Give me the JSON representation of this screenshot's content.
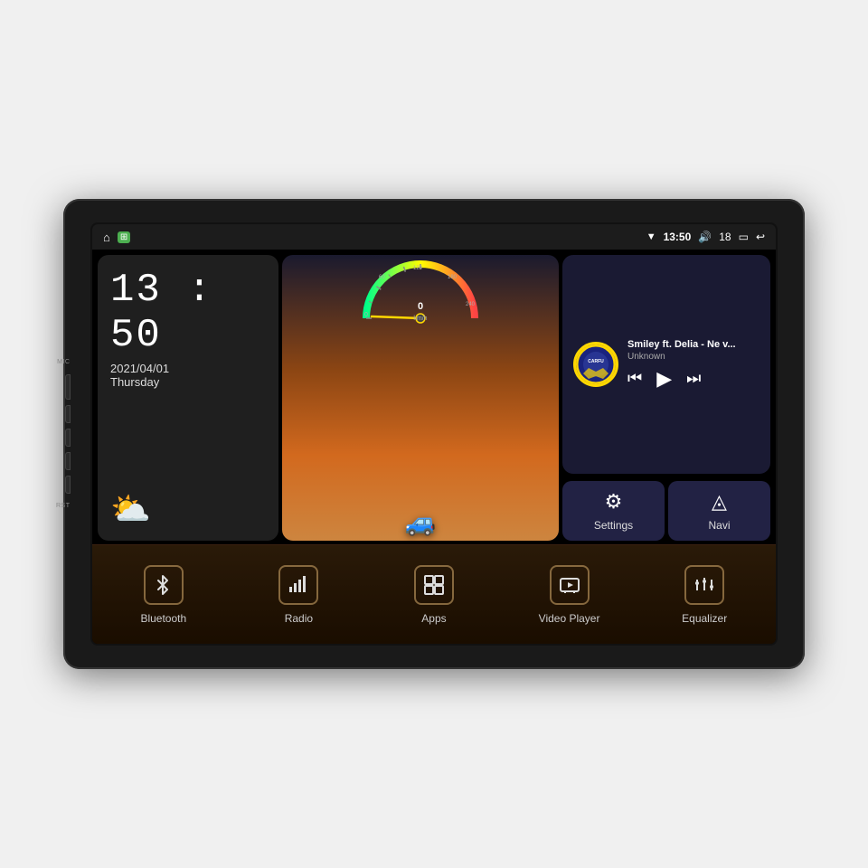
{
  "device": {
    "side_labels": {
      "mic": "MIC",
      "rst": "RST"
    }
  },
  "status_bar": {
    "wifi_icon": "▼",
    "time": "13:50",
    "volume_icon": "🔊",
    "volume_level": "18",
    "battery_icon": "🔋",
    "back_icon": "↩",
    "home_icon": "⌂",
    "app_icon": "⊞"
  },
  "clock": {
    "time": "13 : 50",
    "date": "2021/04/01",
    "day": "Thursday"
  },
  "music": {
    "logo_text": "CARFU",
    "title": "Smiley ft. Delia - Ne v...",
    "artist": "Unknown"
  },
  "settings_btn": {
    "label": "Settings"
  },
  "navi_btn": {
    "label": "Navi"
  },
  "bottom_buttons": [
    {
      "id": "bluetooth",
      "label": "Bluetooth",
      "icon": "bluetooth"
    },
    {
      "id": "radio",
      "label": "Radio",
      "icon": "radio"
    },
    {
      "id": "apps",
      "label": "Apps",
      "icon": "apps"
    },
    {
      "id": "video-player",
      "label": "Video Player",
      "icon": "video"
    },
    {
      "id": "equalizer",
      "label": "Equalizer",
      "icon": "equalizer"
    }
  ],
  "speedometer": {
    "speed": "0",
    "unit": "km/h"
  }
}
